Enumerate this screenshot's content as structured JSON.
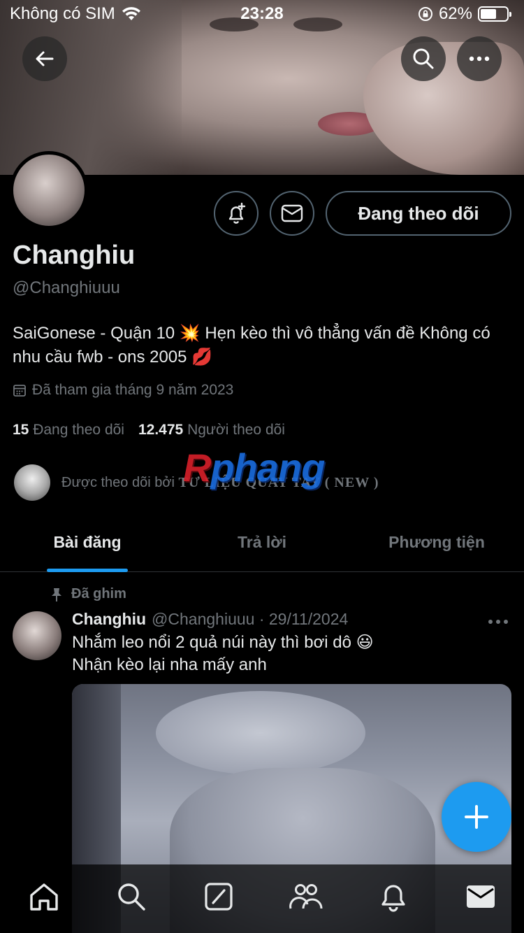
{
  "status_bar": {
    "carrier": "Không có SIM",
    "time": "23:28",
    "battery": "62%",
    "battery_level": 0.62
  },
  "header": {
    "back_icon": "back-arrow-icon",
    "search_icon": "search-icon",
    "more_icon": "more-icon"
  },
  "profile": {
    "name": "Changhiu",
    "handle": "@Changhiuuu",
    "bio": "SaiGonese - Quận 10 💥 Hẹn kèo thì vô thẳng vấn đề Không có nhu cầu fwb - ons 2005 💋",
    "joined": "Đã tham gia tháng 9 năm 2023",
    "following_count": "15",
    "following_label": "Đang theo dõi",
    "followers_count": "12.475",
    "followers_label": "Người theo dõi",
    "followed_by_prefix": "Được theo dõi bởi",
    "followed_by_name": "TƯ LIỆU QUAY TAY ( NEW )",
    "follow_button": "Đang theo dõi"
  },
  "watermark": {
    "r": "R",
    "rest": "phang"
  },
  "tabs": [
    {
      "label": "Bài đăng",
      "active": true
    },
    {
      "label": "Trả lời",
      "active": false
    },
    {
      "label": "Phương tiện",
      "active": false
    }
  ],
  "pinned_post": {
    "pinned_label": "Đã ghim",
    "author": "Changhiu",
    "meta": "@Changhiuuu · 29/11/2024",
    "line1": "Nhắm leo nổi 2 quả núi này thì bơi dô 😃",
    "line2": "Nhận kèo lại nha mấy anh"
  },
  "bottom_nav": [
    "home-icon",
    "search-icon",
    "grok-icon",
    "communities-icon",
    "notifications-icon",
    "messages-icon"
  ],
  "colors": {
    "accent": "#1d9bf0",
    "background": "#000000",
    "text_primary": "#e7e9ea",
    "text_secondary": "#71767b",
    "border": "#536471"
  }
}
